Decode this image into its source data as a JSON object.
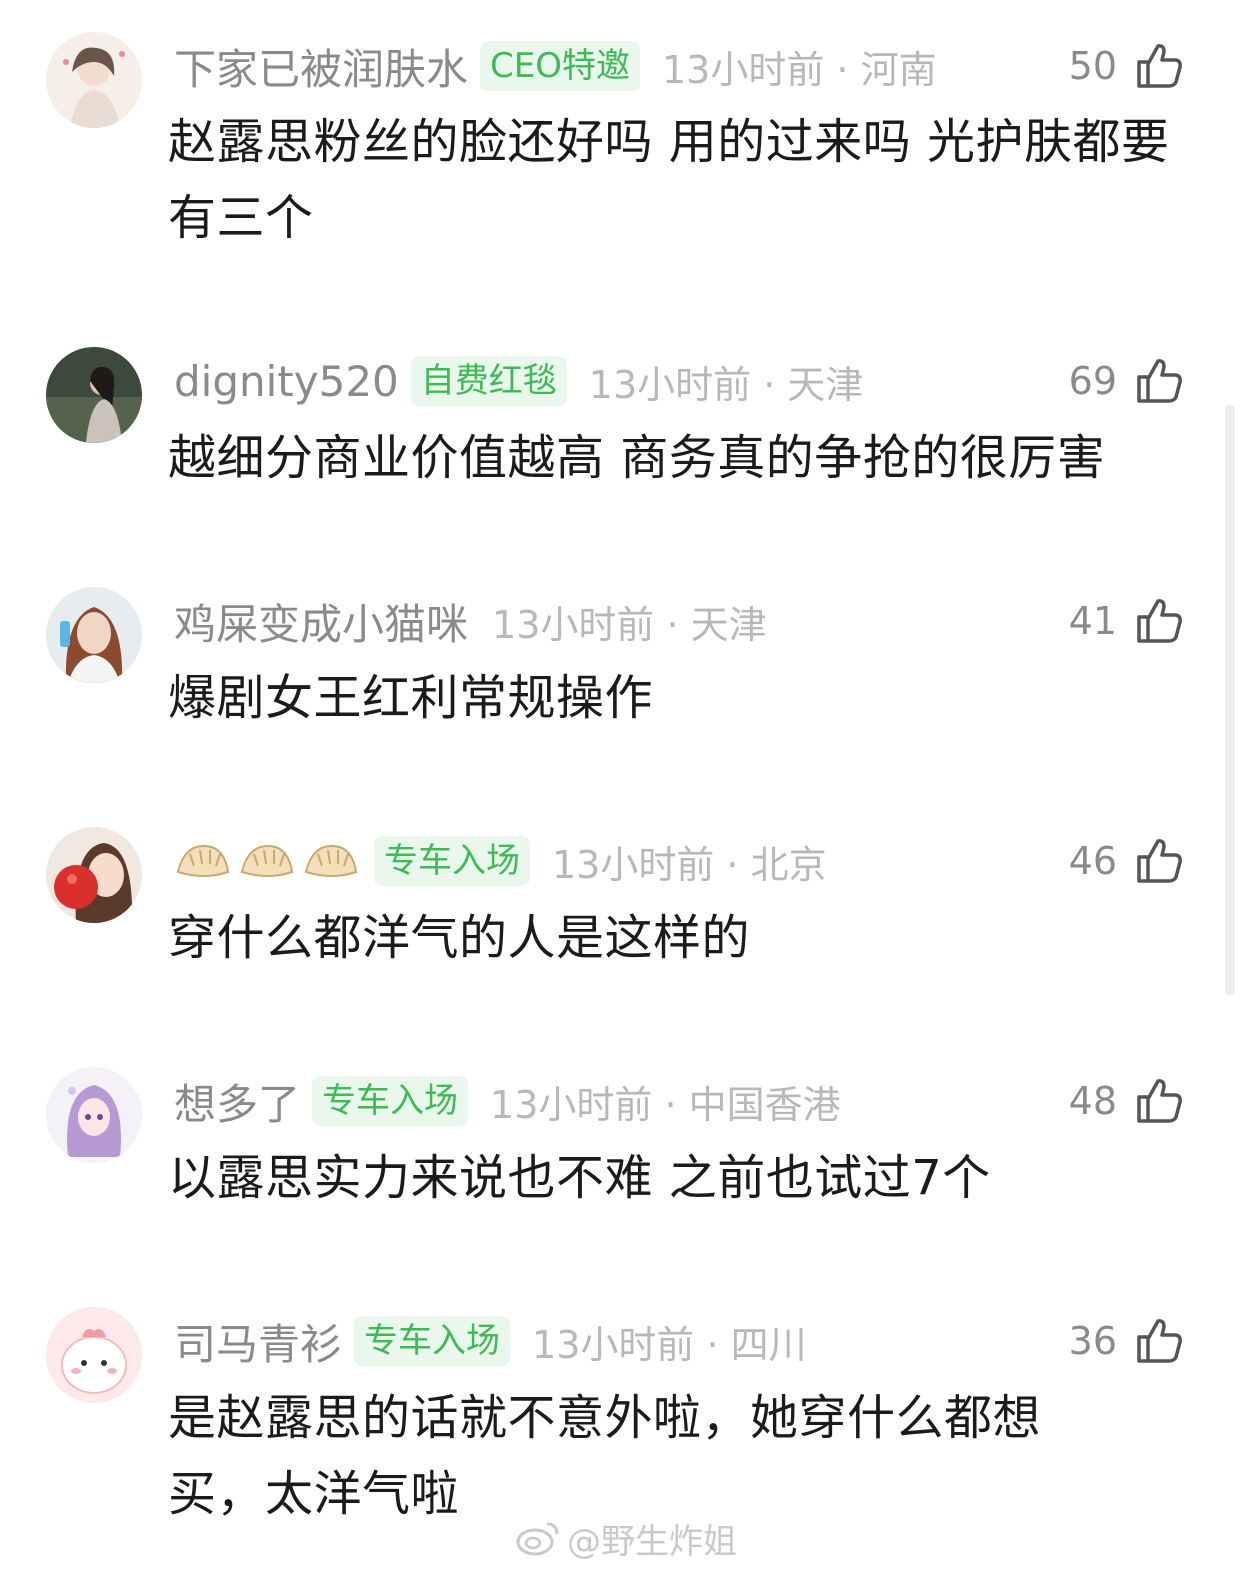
{
  "comments": [
    {
      "username": "下家已被润肤水",
      "badge": "CEO特邀",
      "meta": "13小时前 · 河南",
      "likes": "50",
      "text": "赵露思粉丝的脸还好吗 用的过来吗 光护肤都要有三个"
    },
    {
      "username": "dignity520",
      "badge": "自费红毯",
      "meta": "13小时前 · 天津",
      "likes": "69",
      "text": "越细分商业价值越高 商务真的争抢的很厉害"
    },
    {
      "username": "鸡屎变成小猫咪",
      "badge": "",
      "meta": "13小时前 · 天津",
      "likes": "41",
      "text": "爆剧女王红利常规操作"
    },
    {
      "username": "",
      "badge": "专车入场",
      "meta": "13小时前 · 北京",
      "likes": "46",
      "text": "穿什么都洋气的人是这样的"
    },
    {
      "username": "想多了",
      "badge": "专车入场",
      "meta": "13小时前 · 中国香港",
      "likes": "48",
      "text": "以露思实力来说也不难 之前也试过7个"
    },
    {
      "username": "司马青衫",
      "badge": "专车入场",
      "meta": "13小时前 · 四川",
      "likes": "36",
      "text": "是赵露思的话就不意外啦，她穿什么都想买，太洋气啦"
    }
  ],
  "icons": {
    "like": "thumbs-up-icon",
    "emoji_username": "dumpling-emoji-icon",
    "watermark": "weibo-logo-icon"
  },
  "watermark": {
    "text": "@野生炸姐"
  },
  "colors": {
    "badge_text": "#3dbb55",
    "badge_bg": "#eaf7ec",
    "username": "#8a8a8a",
    "meta": "#b8b8b8",
    "body_text": "#1b1b1b"
  }
}
